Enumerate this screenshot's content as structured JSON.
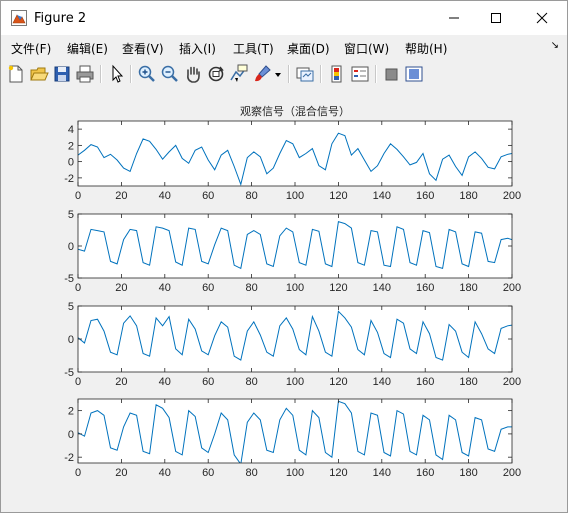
{
  "window": {
    "title": "Figure 2"
  },
  "menu": [
    "文件(F)",
    "编辑(E)",
    "查看(V)",
    "插入(I)",
    "工具(T)",
    "桌面(D)",
    "窗口(W)",
    "帮助(H)"
  ],
  "toolbar_icons": [
    "new-figure-icon",
    "open-file-icon",
    "save-icon",
    "print-icon",
    "pointer-icon",
    "zoom-in-icon",
    "zoom-out-icon",
    "pan-hand-icon",
    "rotate-3d-icon",
    "data-cursor-icon",
    "brush-icon",
    "brush-dropdown-icon",
    "link-plot-icon",
    "colorbar-icon",
    "legend-icon",
    "hide-plot-tools-icon",
    "show-plot-tools-icon"
  ],
  "chart_data": [
    {
      "type": "line",
      "title": "观察信号（混合信号）",
      "xlim": [
        0,
        200
      ],
      "ylim": [
        -3,
        5
      ],
      "xticks": [
        "0",
        "20",
        "40",
        "60",
        "80",
        "100",
        "120",
        "140",
        "160",
        "180",
        "200"
      ],
      "yticks": [
        "-2",
        "0",
        "2",
        "4"
      ],
      "color": "#0072BD",
      "x": [
        0,
        3,
        6,
        9,
        12,
        15,
        18,
        21,
        24,
        27,
        30,
        33,
        36,
        39,
        42,
        45,
        48,
        51,
        54,
        57,
        60,
        63,
        66,
        69,
        72,
        75,
        78,
        81,
        84,
        87,
        90,
        93,
        96,
        99,
        102,
        105,
        108,
        111,
        114,
        117,
        120,
        123,
        126,
        129,
        132,
        135,
        138,
        141,
        144,
        147,
        150,
        153,
        156,
        159,
        162,
        165,
        168,
        171,
        174,
        177,
        180,
        183,
        186,
        189,
        192,
        195,
        198,
        200
      ],
      "values": [
        0.8,
        1.4,
        2.1,
        1.8,
        0.5,
        0.9,
        0.2,
        -0.8,
        -1.2,
        1.0,
        2.8,
        2.5,
        1.5,
        0.3,
        1.2,
        2.0,
        0.4,
        -0.2,
        1.4,
        1.8,
        0.2,
        -1.0,
        0.8,
        1.4,
        -0.6,
        -2.8,
        0.5,
        1.2,
        0.6,
        -1.5,
        -0.8,
        1.0,
        2.6,
        2.2,
        0.5,
        1.0,
        1.6,
        -0.5,
        -1.0,
        2.2,
        3.5,
        3.2,
        0.8,
        1.6,
        0.2,
        -1.2,
        -0.5,
        1.0,
        2.2,
        1.5,
        0.6,
        -0.4,
        -0.1,
        1.0,
        -1.5,
        -2.3,
        0.3,
        0.8,
        -0.6,
        -1.7,
        0.6,
        1.2,
        0.4,
        -0.7,
        -0.9,
        0.6,
        0.9,
        1.0
      ]
    },
    {
      "type": "line",
      "xlim": [
        0,
        200
      ],
      "ylim": [
        -5,
        5
      ],
      "xticks": [
        "0",
        "20",
        "40",
        "60",
        "80",
        "100",
        "120",
        "140",
        "160",
        "180",
        "200"
      ],
      "yticks": [
        "-5",
        "0",
        "5"
      ],
      "color": "#0072BD",
      "x": [
        0,
        3,
        6,
        9,
        12,
        15,
        18,
        21,
        24,
        27,
        30,
        33,
        36,
        39,
        42,
        45,
        48,
        51,
        54,
        57,
        60,
        63,
        66,
        69,
        72,
        75,
        78,
        81,
        84,
        87,
        90,
        93,
        96,
        99,
        102,
        105,
        108,
        111,
        114,
        117,
        120,
        123,
        126,
        129,
        132,
        135,
        138,
        141,
        144,
        147,
        150,
        153,
        156,
        159,
        162,
        165,
        168,
        171,
        174,
        177,
        180,
        183,
        186,
        189,
        192,
        195,
        198,
        200
      ],
      "values": [
        -0.5,
        -0.8,
        2.6,
        2.4,
        2.2,
        -2.4,
        -2.8,
        1.0,
        2.6,
        2.4,
        -2.6,
        -3.0,
        3.0,
        2.8,
        2.4,
        -2.5,
        -3.0,
        2.8,
        2.6,
        -2.4,
        -2.8,
        0.2,
        2.8,
        2.4,
        -3.0,
        -3.5,
        1.8,
        2.4,
        1.8,
        -2.8,
        -3.2,
        1.6,
        2.8,
        2.2,
        -2.6,
        -3.0,
        2.6,
        2.3,
        -2.8,
        -3.2,
        3.8,
        3.5,
        2.8,
        -2.6,
        -3.0,
        2.4,
        2.2,
        -3.0,
        -3.2,
        3.0,
        2.6,
        -2.6,
        -3.0,
        2.4,
        2.1,
        -3.2,
        -3.5,
        2.6,
        2.2,
        -2.8,
        -3.2,
        2.2,
        2.0,
        -2.4,
        -2.6,
        1.0,
        1.2,
        1.0
      ]
    },
    {
      "type": "line",
      "xlim": [
        0,
        200
      ],
      "ylim": [
        -5,
        5
      ],
      "xticks": [
        "0",
        "20",
        "40",
        "60",
        "80",
        "100",
        "120",
        "140",
        "160",
        "180",
        "200"
      ],
      "yticks": [
        "-5",
        "0",
        "5"
      ],
      "color": "#0072BD",
      "x": [
        0,
        3,
        6,
        9,
        12,
        15,
        18,
        21,
        24,
        27,
        30,
        33,
        36,
        39,
        42,
        45,
        48,
        51,
        54,
        57,
        60,
        63,
        66,
        69,
        72,
        75,
        78,
        81,
        84,
        87,
        90,
        93,
        96,
        99,
        102,
        105,
        108,
        111,
        114,
        117,
        120,
        123,
        126,
        129,
        132,
        135,
        138,
        141,
        144,
        147,
        150,
        153,
        156,
        159,
        162,
        165,
        168,
        171,
        174,
        177,
        180,
        183,
        186,
        189,
        192,
        195,
        198,
        200
      ],
      "values": [
        0.2,
        -0.6,
        2.8,
        3.0,
        1.2,
        -2.0,
        -2.4,
        2.4,
        3.5,
        2.0,
        -2.2,
        -2.6,
        3.2,
        2.0,
        3.4,
        -1.5,
        -2.4,
        3.0,
        1.5,
        -1.8,
        -2.4,
        0.5,
        2.6,
        1.8,
        -2.6,
        -3.2,
        1.2,
        2.6,
        0.6,
        -2.0,
        -2.6,
        2.0,
        3.2,
        1.5,
        -1.6,
        -2.4,
        3.4,
        1.2,
        -2.0,
        -2.6,
        4.2,
        3.2,
        1.8,
        -1.6,
        -2.4,
        2.8,
        1.0,
        -2.2,
        -2.8,
        3.0,
        2.4,
        -1.5,
        -2.2,
        2.6,
        0.8,
        -2.8,
        -3.2,
        2.2,
        1.2,
        -2.0,
        -2.8,
        2.6,
        0.8,
        -1.5,
        -2.2,
        1.6,
        2.0,
        2.1
      ]
    },
    {
      "type": "line",
      "xlim": [
        0,
        200
      ],
      "ylim": [
        -2.5,
        3
      ],
      "xticks": [
        "0",
        "20",
        "40",
        "60",
        "80",
        "100",
        "120",
        "140",
        "160",
        "180",
        "200"
      ],
      "yticks": [
        "-2",
        "0",
        "2"
      ],
      "color": "#0072BD",
      "x": [
        0,
        3,
        6,
        9,
        12,
        15,
        18,
        21,
        24,
        27,
        30,
        33,
        36,
        39,
        42,
        45,
        48,
        51,
        54,
        57,
        60,
        63,
        66,
        69,
        72,
        75,
        78,
        81,
        84,
        87,
        90,
        93,
        96,
        99,
        102,
        105,
        108,
        111,
        114,
        117,
        120,
        123,
        126,
        129,
        132,
        135,
        138,
        141,
        144,
        147,
        150,
        153,
        156,
        159,
        162,
        165,
        168,
        171,
        174,
        177,
        180,
        183,
        186,
        189,
        192,
        195,
        198,
        200
      ],
      "values": [
        0.1,
        -0.2,
        1.8,
        2.0,
        1.6,
        -1.2,
        -1.4,
        0.6,
        1.8,
        1.6,
        -1.5,
        -1.7,
        2.5,
        2.2,
        1.4,
        -1.5,
        -1.8,
        2.0,
        1.5,
        -1.2,
        -1.6,
        0.0,
        1.8,
        1.2,
        -1.8,
        -2.6,
        1.0,
        1.8,
        1.2,
        -1.4,
        -1.6,
        1.2,
        2.2,
        1.6,
        -1.4,
        -1.8,
        2.0,
        1.4,
        -1.6,
        -2.0,
        2.8,
        2.6,
        1.8,
        -1.5,
        -1.8,
        1.8,
        1.6,
        -1.6,
        -1.9,
        2.0,
        1.7,
        -1.5,
        -1.8,
        1.6,
        1.2,
        -1.8,
        -2.2,
        1.6,
        1.2,
        -1.6,
        -1.9,
        1.4,
        1.2,
        -1.3,
        -1.5,
        0.4,
        0.6,
        0.6
      ]
    }
  ]
}
